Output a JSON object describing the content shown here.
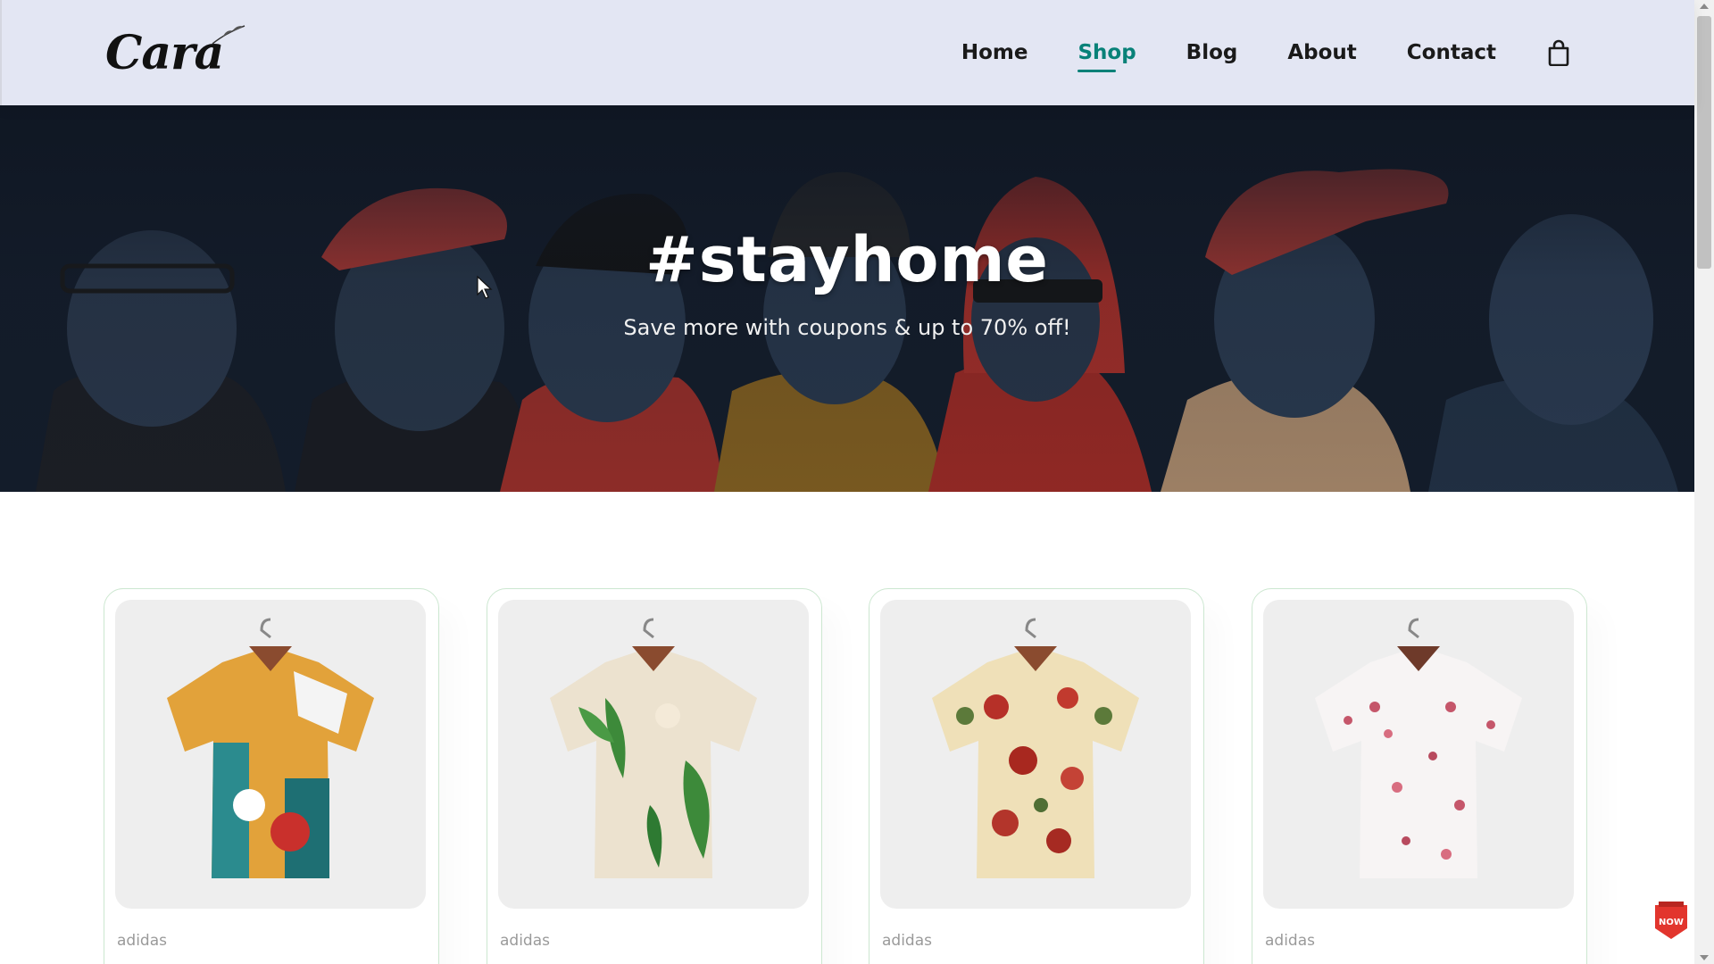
{
  "header": {
    "logo_text": "Cara",
    "nav": [
      {
        "label": "Home",
        "active": false
      },
      {
        "label": "Shop",
        "active": true
      },
      {
        "label": "Blog",
        "active": false
      },
      {
        "label": "About",
        "active": false
      },
      {
        "label": "Contact",
        "active": false
      }
    ],
    "cart_icon": "shopping-bag-icon"
  },
  "hero": {
    "title": "#stayhome",
    "subtitle": "Save more with coupons & up to 70% off!"
  },
  "products": [
    {
      "brand": "adidas",
      "pattern": "colorful-abstract-shirt"
    },
    {
      "brand": "adidas",
      "pattern": "green-leaf-floral-shirt"
    },
    {
      "brand": "adidas",
      "pattern": "red-floral-cream-shirt"
    },
    {
      "brand": "adidas",
      "pattern": "pink-blossom-white-shirt"
    }
  ],
  "watermark": {
    "text": "NOW"
  },
  "colors": {
    "accent": "#088178",
    "header_bg": "#e3e6f3",
    "hero_bg": "#0f1622"
  }
}
